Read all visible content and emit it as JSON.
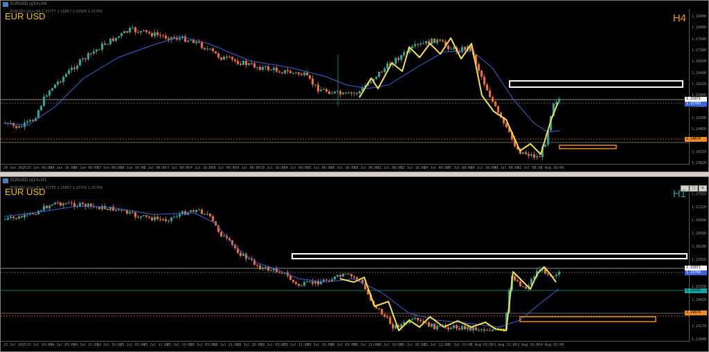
{
  "colors": {
    "bull": "#26a69a",
    "bear": "#f46b2c",
    "zigzag": "#f5e050",
    "ma": "#3c64dc",
    "zone_white": "#ffffff",
    "zone_orange": "#f08a24",
    "symbol": "#f5c400",
    "tf_h4": "#f59a00",
    "tf_h1": "#12a6a0"
  },
  "top": {
    "window_title": "EURUSD.oj1m,H4",
    "ohlc": "EURUSD.oj1m,H4  1.15777 1.15857 1.15500 1.15769",
    "symbol_label": "EUR USD",
    "timeframe_label": "H4",
    "price_ticks": [
      "1.18400",
      "1.18000",
      "1.17640",
      "1.17280",
      "1.16930",
      "1.16490",
      "1.16120",
      "1.15800",
      "1.15520",
      "1.15200",
      "1.14850",
      "1.14500",
      "1.14210",
      "1.13820"
    ],
    "price_label_current": "1.15871",
    "price_label_bid": "1.15769",
    "price_label_support": "1.14674",
    "time_ticks": [
      "20 Jun 2025",
      "23 Jun 08:00",
      "24 Jun 16:00",
      "26 Jun 00:00",
      "27 Jun 08:00",
      "30 Jun 16:00",
      "2 Jul 00:00",
      "3 Jul 08:00",
      "4 Jul 16:00",
      "8 Jul 00:00",
      "9 Jul 08:00",
      "10 Jul 16:00",
      "14 Jul 00:00",
      "15 Jul 08:00",
      "16 Jul 16:00",
      "18 Jul 00:00",
      "21 Jul 08:00",
      "22 Jul 16:00",
      "24 Jul 00:00",
      "25 Jul 08:00",
      "28 Jul 16:00",
      "30 Jul 00:00",
      "31 Jul 08:00",
      "1 Aug 16:00"
    ]
  },
  "bottom": {
    "window_title": "EURUSD.oj1m,H1",
    "ohlc": "EURUSD.oj1m,H1  1.15755 1.15857 1.15750 1.15769",
    "symbol_label": "EUR USD",
    "timeframe_label": "H1",
    "price_ticks": [
      "1.17550",
      "1.17220",
      "1.16890",
      "1.16560",
      "1.16240",
      "1.15910",
      "1.15580",
      "1.15250",
      "1.14920",
      "1.14600",
      "1.14270",
      "1.13940"
    ],
    "price_label_current": "1.15871",
    "price_label_bid": "1.15769",
    "price_label_mid": "1.15155",
    "price_label_support": "1.14674",
    "time_ticks": [
      "23 Jul 2025",
      "23 Jul 19:00",
      "24 Jul 03:00",
      "24 Jul 11:00",
      "24 Jul 19:00",
      "25 Jul 03:00",
      "25 Jul 11:00",
      "25 Jul 19:00",
      "28 Jul 03:00",
      "28 Jul 11:00",
      "28 Jul 19:00",
      "29 Jul 03:00",
      "29 Jul 11:00",
      "29 Jul 19:00",
      "30 Jul 03:00",
      "30 Jul 11:00",
      "30 Jul 19:00",
      "31 Jul 03:00",
      "31 Jul 11:00",
      "31 Jul 19:00",
      "1 Aug 03:00",
      "1 Aug 11:00",
      "1 Aug 19:00",
      "4 Aug 03:00"
    ]
  }
}
